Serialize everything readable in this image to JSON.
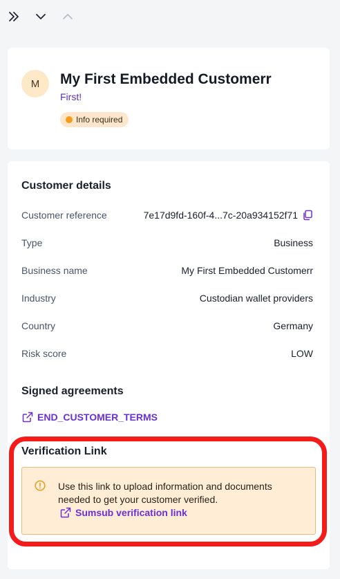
{
  "toolbar": {
    "expand_icon": "double-chevron-right-icon",
    "next_icon": "chevron-down-icon",
    "prev_icon": "chevron-up-icon"
  },
  "customer": {
    "avatar_initial": "M",
    "name": "My First Embedded Customerr",
    "subtitle": "First!",
    "status_badge": "Info required"
  },
  "details": {
    "title": "Customer details",
    "rows": [
      {
        "label": "Customer reference",
        "value": "7e17d9fd-160f-4...7c-20a934152f71"
      },
      {
        "label": "Type",
        "value": "Business"
      },
      {
        "label": "Business name",
        "value": "My First Embedded Customerr"
      },
      {
        "label": "Industry",
        "value": "Custodian wallet providers"
      },
      {
        "label": "Country",
        "value": "Germany"
      },
      {
        "label": "Risk score",
        "value": "LOW"
      }
    ]
  },
  "agreements": {
    "title": "Signed agreements",
    "link": "END_CUSTOMER_TERMS"
  },
  "verification": {
    "title": "Verification Link",
    "message": "Use this link to upload information and documents needed to get your customer verified.",
    "link": "Sumsub verification link"
  },
  "colors": {
    "accent": "#6b2fd4",
    "badge_bg": "#fde7cc",
    "badge_dot": "#f59c1a",
    "warning_bg": "#ffeed5",
    "highlight": "#f41b1b"
  }
}
